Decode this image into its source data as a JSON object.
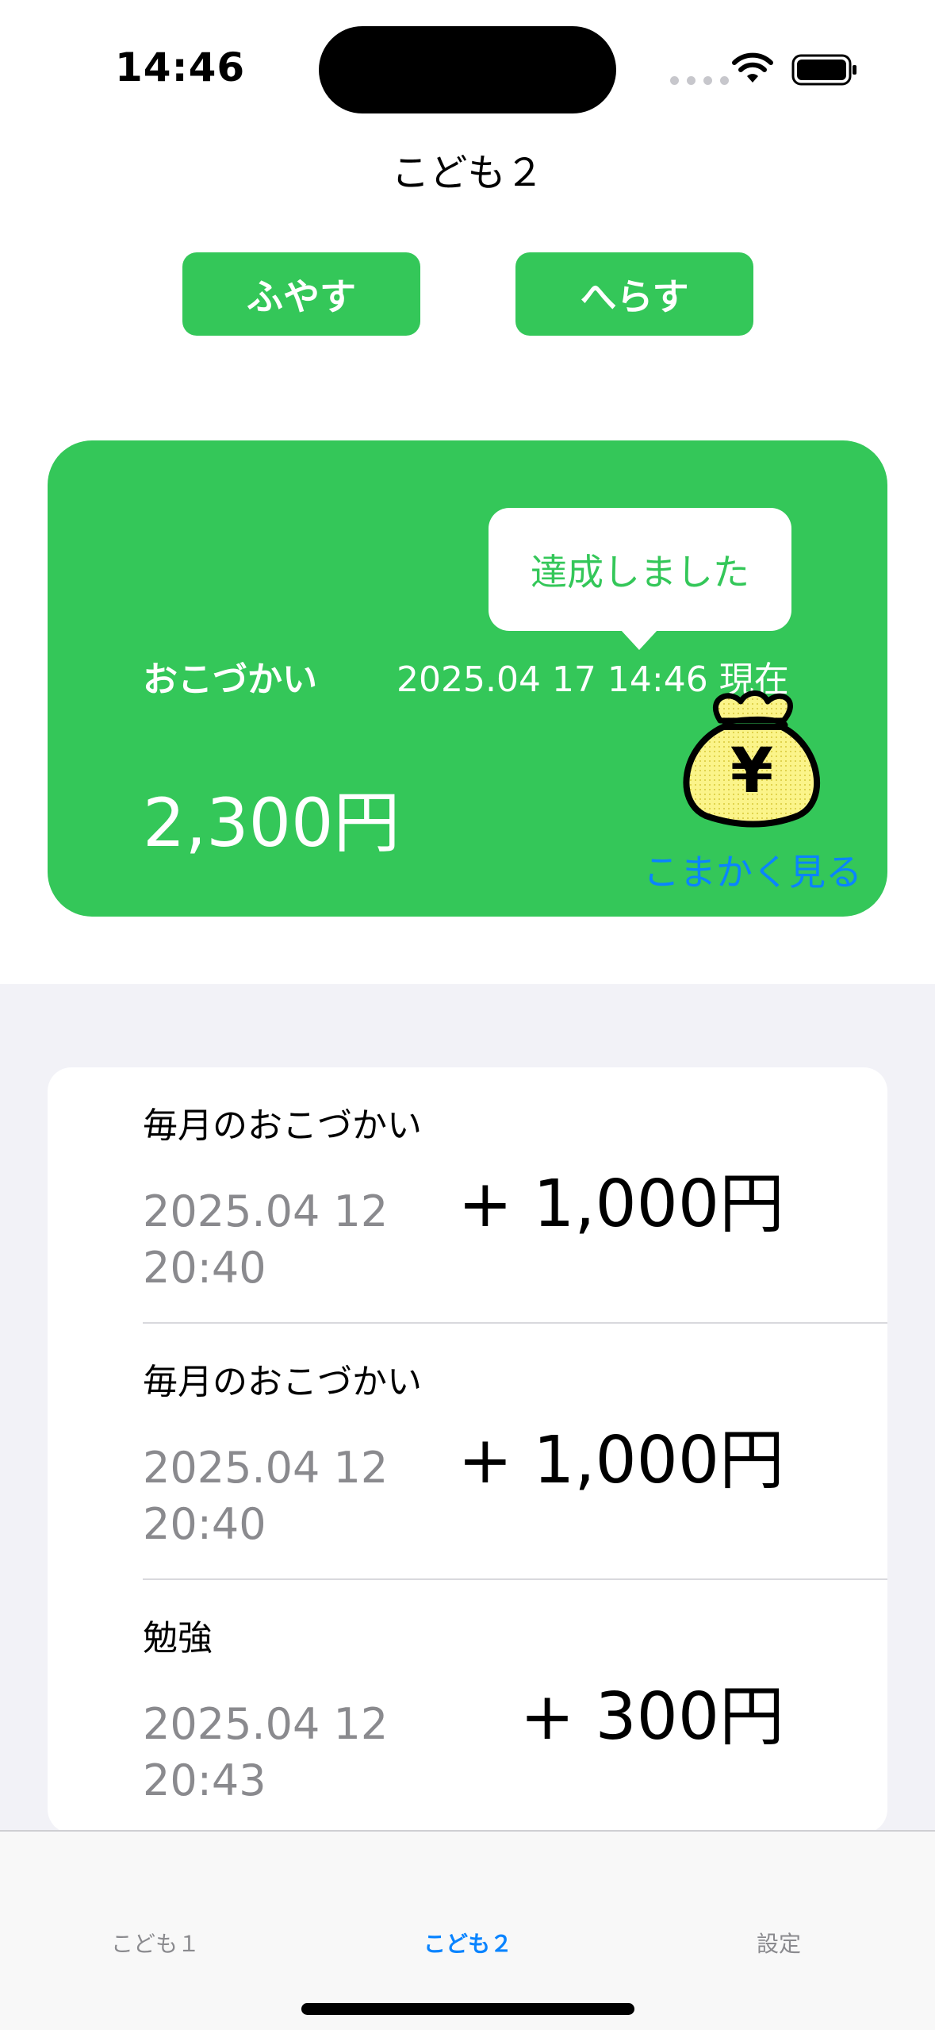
{
  "status_bar": {
    "time": "14:46"
  },
  "nav": {
    "title": "こども２"
  },
  "actions": {
    "increase_label": "ふやす",
    "decrease_label": "へらす"
  },
  "allowance_card": {
    "label": "おこづかい",
    "timestamp": "2025.04 17 14:46 現在",
    "amount": "2,300円",
    "tooltip": "達成しました",
    "details_link": "こまかく見る",
    "icon": "money-bag-yen-icon"
  },
  "history": {
    "items": [
      {
        "title": "毎月のおこづかい",
        "date": "2025.04 12 20:40",
        "amount": "+ 1,000円"
      },
      {
        "title": "毎月のおこづかい",
        "date": "2025.04 12 20:40",
        "amount": "+ 1,000円"
      },
      {
        "title": "勉強",
        "date": "2025.04 12 20:43",
        "amount": "+ 300円"
      }
    ]
  },
  "tab_bar": {
    "tabs": [
      {
        "label": "こども１",
        "selected": false
      },
      {
        "label": "こども２",
        "selected": true
      },
      {
        "label": "設定",
        "selected": false
      }
    ]
  },
  "colors": {
    "accent_green": "#34c759",
    "link_blue": "#0a84ff",
    "secondary_gray": "#8a8a8e",
    "list_background": "#f2f2f7"
  }
}
